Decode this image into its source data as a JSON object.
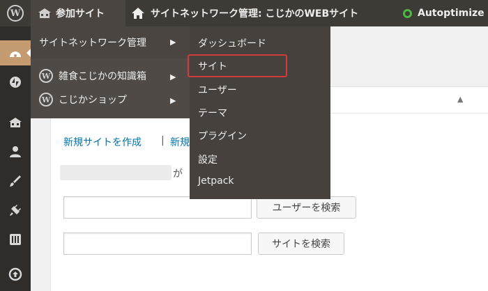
{
  "adminbar": {
    "wp_logo": "W",
    "my_sites_label": "参加サイト",
    "network_title": "サイトネットワーク管理: こじかのWEBサイト",
    "autoptimize_label": "Autoptimize",
    "icons": {
      "wp": "wordpress-icon",
      "my_sites": "network-icon",
      "network": "home-icon",
      "autoptimize": "status-ring-icon"
    },
    "status_color": "#4bb845"
  },
  "menu": {
    "items": [
      "dashboard-icon",
      "jetpack-icon",
      "sites-icon",
      "users-icon",
      "themes-icon",
      "plugins-icon",
      "settings-icon",
      "updraft-icon"
    ]
  },
  "dropdown": {
    "network_admin_label": "サイトネットワーク管理",
    "sites": [
      {
        "label": "雑食こじかの知識箱"
      },
      {
        "label": "こじかショップ"
      }
    ]
  },
  "submenu": {
    "items": [
      "ダッシュボード",
      "サイト",
      "ユーザー",
      "テーマ",
      "プラグイン",
      "設定",
      "Jetpack"
    ],
    "highlighted": "サイト",
    "highlight_color": "#d23b3b"
  },
  "content": {
    "panel_toggle": "▲",
    "create_site_link": "新規サイトを作成",
    "separator": "|",
    "create_user_link_partial": "新規",
    "blurred_suffix": "が",
    "search_users_button": "ユーザーを検索",
    "search_sites_button": "サイトを検索"
  }
}
